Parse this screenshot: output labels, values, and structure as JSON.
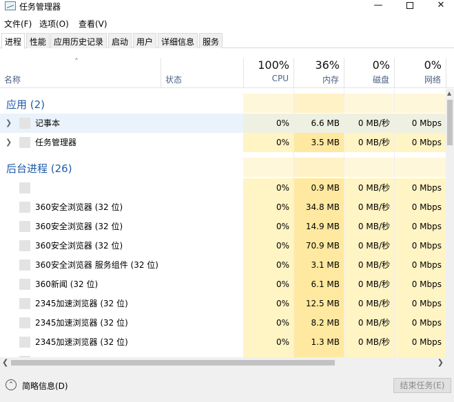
{
  "window": {
    "title": "任务管理器"
  },
  "menu": [
    "文件(F)",
    "选项(O)",
    "查看(V)"
  ],
  "tabs": [
    "进程",
    "性能",
    "应用历史记录",
    "启动",
    "用户",
    "详细信息",
    "服务"
  ],
  "columns": {
    "name": "名称",
    "status": "状态",
    "cpu": {
      "pct": "100%",
      "label": "CPU"
    },
    "memory": {
      "pct": "36%",
      "label": "内存"
    },
    "disk": {
      "pct": "0%",
      "label": "磁盘"
    },
    "network": {
      "pct": "0%",
      "label": "网络"
    }
  },
  "groups": {
    "apps": "应用 (2)",
    "background": "后台进程 (26)"
  },
  "apps": [
    {
      "name": "记事本",
      "cpu": "0%",
      "mem": "6.6 MB",
      "disk": "0 MB/秒",
      "net": "0 Mbps"
    },
    {
      "name": "任务管理器",
      "cpu": "0%",
      "mem": "3.5 MB",
      "disk": "0 MB/秒",
      "net": "0 Mbps"
    }
  ],
  "background": [
    {
      "name": "",
      "cpu": "0%",
      "mem": "0.9 MB",
      "disk": "0 MB/秒",
      "net": "0 Mbps"
    },
    {
      "name": "360安全浏览器 (32 位)",
      "cpu": "0%",
      "mem": "34.8 MB",
      "disk": "0 MB/秒",
      "net": "0 Mbps"
    },
    {
      "name": "360安全浏览器 (32 位)",
      "cpu": "0%",
      "mem": "14.9 MB",
      "disk": "0 MB/秒",
      "net": "0 Mbps"
    },
    {
      "name": "360安全浏览器 (32 位)",
      "cpu": "0%",
      "mem": "70.9 MB",
      "disk": "0 MB/秒",
      "net": "0 Mbps"
    },
    {
      "name": "360安全浏览器 服务组件 (32 位)",
      "cpu": "0%",
      "mem": "3.1 MB",
      "disk": "0 MB/秒",
      "net": "0 Mbps"
    },
    {
      "name": "360新闻 (32 位)",
      "cpu": "0%",
      "mem": "6.1 MB",
      "disk": "0 MB/秒",
      "net": "0 Mbps"
    },
    {
      "name": "2345加速浏览器 (32 位)",
      "cpu": "0%",
      "mem": "12.5 MB",
      "disk": "0 MB/秒",
      "net": "0 Mbps"
    },
    {
      "name": "2345加速浏览器 (32 位)",
      "cpu": "0%",
      "mem": "8.2 MB",
      "disk": "0 MB/秒",
      "net": "0 Mbps"
    },
    {
      "name": "2345加速浏览器 (32 位)",
      "cpu": "0%",
      "mem": "1.3 MB",
      "disk": "0 MB/秒",
      "net": "0 Mbps"
    }
  ],
  "footer": {
    "fewer_details": "简略信息(D)",
    "end_task": "结束任务(E)"
  }
}
